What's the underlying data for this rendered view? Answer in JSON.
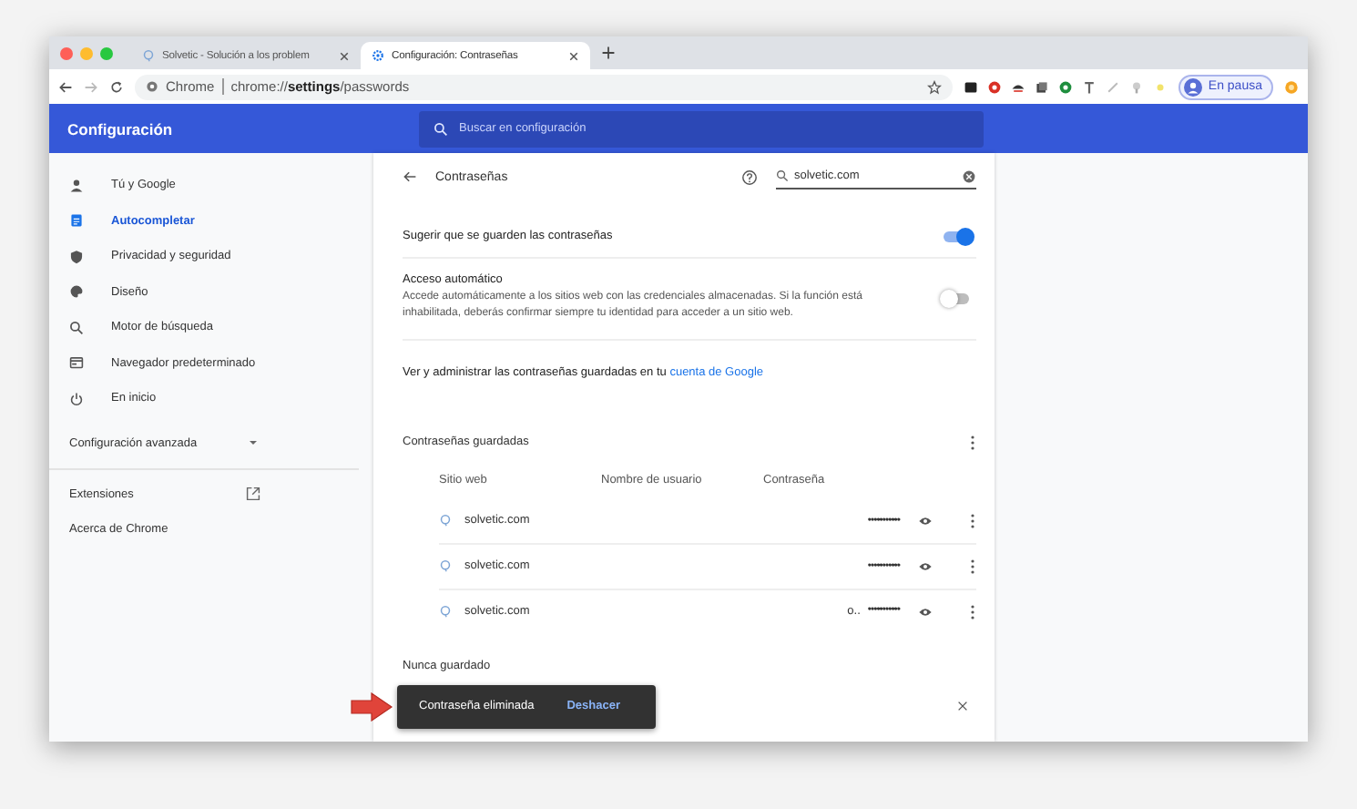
{
  "tabs": [
    {
      "title": "Solvetic - Solución a los problem",
      "selected": false
    },
    {
      "title": "Configuración: Contraseñas",
      "selected": true
    }
  ],
  "address": {
    "origin": "Chrome",
    "url": "chrome://**settings**/passwords"
  },
  "profile": {
    "label": "En pausa"
  },
  "header": {
    "title": "Configuración",
    "search_placeholder": "Buscar en configuración"
  },
  "sidebar": {
    "items": [
      {
        "label": "Tú y Google",
        "selected": false
      },
      {
        "label": "Autocompletar",
        "selected": true
      },
      {
        "label": "Privacidad y seguridad",
        "selected": false
      },
      {
        "label": "Diseño",
        "selected": false
      },
      {
        "label": "Motor de búsqueda",
        "selected": false
      },
      {
        "label": "Navegador predeterminado",
        "selected": false
      },
      {
        "label": "En inicio",
        "selected": false
      }
    ],
    "advanced": {
      "label": "Configuración avanzada",
      "expanded": false
    },
    "extensions": "Extensiones",
    "about": "Acerca de Chrome"
  },
  "passwords": {
    "title": "Contraseñas",
    "search_value": "solvetic.com",
    "settings": [
      {
        "label": "Sugerir que se guarden las contraseñas",
        "on": true
      },
      {
        "label": "Acceso automático",
        "description": "Accede automáticamente a los sitios web con las credenciales almacenadas. Si la función está inhabilitada, deberás confirmar siempre tu identidad para acceder a un sitio web.",
        "on": false
      }
    ],
    "manage_text": "Ver y administrar las contraseñas guardadas en tu",
    "manage_link": "cuenta de Google",
    "saved_title": "Contraseñas guardadas",
    "columns": [
      "Sitio web",
      "Nombre de usuario",
      "Contraseña"
    ],
    "rows": [
      {
        "site": "solvetic.com",
        "password": "•••••••••••"
      },
      {
        "site": "solvetic.com",
        "password": "•••••••••••"
      },
      {
        "site": "solvetic.com",
        "username": "o..",
        "password": "•••••••••••"
      }
    ],
    "never_saved_title": "Nunca guardado"
  },
  "snackbar": {
    "message": "Contraseña eliminada",
    "action": "Deshacer"
  }
}
